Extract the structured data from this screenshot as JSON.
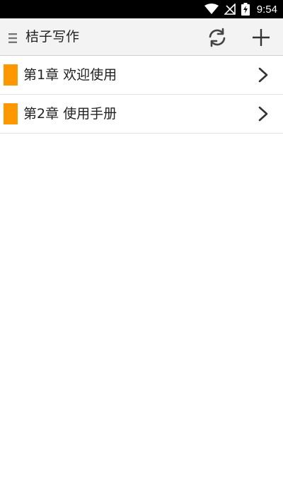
{
  "status_bar": {
    "time": "9:54",
    "icons": [
      "wifi-icon",
      "no-signal-icon",
      "battery-charging-icon"
    ],
    "color": "#000000"
  },
  "toolbar": {
    "title": "桔子写作",
    "menu_icon": "menu-icon",
    "refresh_icon": "refresh-icon",
    "add_icon": "add-icon",
    "background": "#f3f3f3"
  },
  "chapters": [
    {
      "label": "第1章 欢迎使用",
      "marker_color": "#ff9800",
      "icon": "chevron-right-icon"
    },
    {
      "label": "第2章 使用手册",
      "marker_color": "#ff9800",
      "icon": "chevron-right-icon"
    }
  ]
}
